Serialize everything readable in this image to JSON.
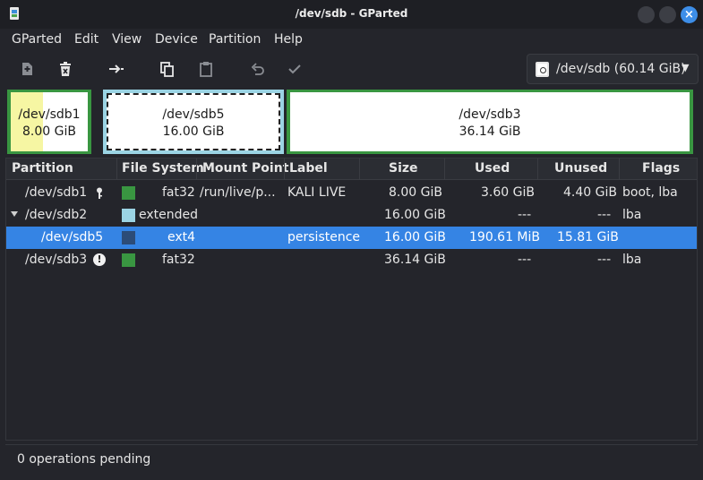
{
  "window": {
    "title": "/dev/sdb - GParted"
  },
  "menu": [
    "GParted",
    "Edit",
    "View",
    "Device",
    "Partition",
    "Help"
  ],
  "device": {
    "label": "/dev/sdb (60.14 GiB)"
  },
  "graphic": {
    "sdb1": {
      "name": "/dev/sdb1",
      "size": "8.00 GiB"
    },
    "sdb5": {
      "name": "/dev/sdb5",
      "size": "16.00 GiB"
    },
    "sdb3": {
      "name": "/dev/sdb3",
      "size": "36.14 GiB"
    }
  },
  "columns": [
    "Partition",
    "File System",
    "Mount Point",
    "Label",
    "Size",
    "Used",
    "Unused",
    "Flags"
  ],
  "rows": [
    {
      "partition": "/dev/sdb1",
      "fs": "fat32",
      "mount": "/run/live/p...",
      "label": "KALI LIVE",
      "size": "8.00 GiB",
      "used": "3.60 GiB",
      "unused": "4.40 GiB",
      "flags": "boot, lba",
      "color": "#399641"
    },
    {
      "partition": "/dev/sdb2",
      "fs": "extended",
      "mount": "",
      "label": "",
      "size": "16.00 GiB",
      "used": "---",
      "unused": "---",
      "flags": "lba",
      "color": "#9bd4e4"
    },
    {
      "partition": "/dev/sdb5",
      "fs": "ext4",
      "mount": "",
      "label": "persistence",
      "size": "16.00 GiB",
      "used": "190.61 MiB",
      "unused": "15.81 GiB",
      "flags": "",
      "color": "#2c4c78"
    },
    {
      "partition": "/dev/sdb3",
      "fs": "fat32",
      "mount": "",
      "label": "",
      "size": "36.14 GiB",
      "used": "---",
      "unused": "---",
      "flags": "lba",
      "color": "#399641"
    }
  ],
  "status": "0 operations pending",
  "colors": {
    "accent": "#3584e4",
    "fat32": "#399641",
    "extended": "#9bd4e4",
    "ext4": "#2c4c78"
  }
}
